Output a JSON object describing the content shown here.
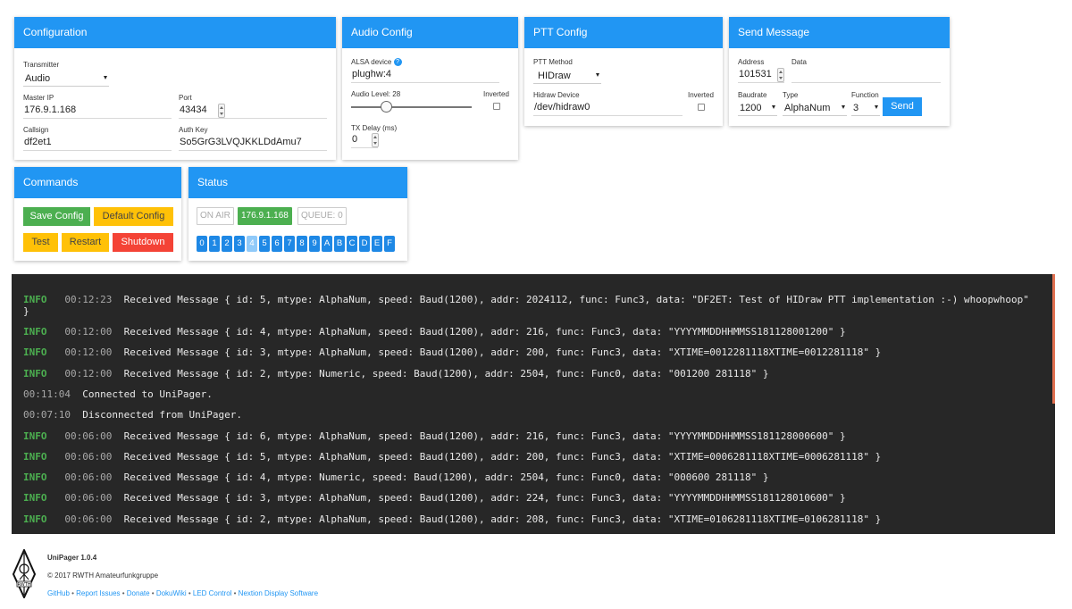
{
  "config": {
    "title": "Configuration",
    "transmitter_label": "Transmitter",
    "transmitter_value": "Audio",
    "master_ip_label": "Master IP",
    "master_ip_value": "176.9.1.168",
    "port_label": "Port",
    "port_value": "43434",
    "callsign_label": "Callsign",
    "callsign_value": "df2et1",
    "auth_key_label": "Auth Key",
    "auth_key_value": "So5GrG3LVQJKKLDdAmu7"
  },
  "audio": {
    "title": "Audio Config",
    "device_label": "ALSA device",
    "device_value": "plughw:4",
    "level_label": "Audio Level: 28",
    "level_value": 28,
    "inverted_label": "Inverted",
    "tx_delay_label": "TX Delay (ms)",
    "tx_delay_value": "0"
  },
  "ptt": {
    "title": "PTT Config",
    "method_label": "PTT Method",
    "method_value": "HIDraw",
    "hidraw_label": "Hidraw Device",
    "hidraw_value": "/dev/hidraw0",
    "inverted_label": "Inverted"
  },
  "send": {
    "title": "Send Message",
    "address_label": "Address",
    "address_value": "101531",
    "data_label": "Data",
    "data_value": "",
    "baudrate_label": "Baudrate",
    "baudrate_value": "1200",
    "type_label": "Type",
    "type_value": "AlphaNum",
    "function_label": "Function",
    "function_value": "3",
    "send_button": "Send"
  },
  "commands": {
    "title": "Commands",
    "save": "Save Config",
    "default": "Default Config",
    "test": "Test",
    "restart": "Restart",
    "shutdown": "Shutdown"
  },
  "status": {
    "title": "Status",
    "on_air": "ON AIR",
    "master": "176.9.1.168",
    "queue": "QUEUE: 0",
    "slots": [
      "0",
      "1",
      "2",
      "3",
      "4",
      "5",
      "6",
      "7",
      "8",
      "9",
      "A",
      "B",
      "C",
      "D",
      "E",
      "F"
    ],
    "active_slot": "4"
  },
  "log": [
    {
      "level": "INFO",
      "time": "00:12:23",
      "msg": "Received Message { id: 5, mtype: AlphaNum, speed: Baud(1200), addr: 2024112, func: Func3, data: \"DF2ET: Test of HIDraw PTT implementation :-) whoopwhoop\"",
      "cont": "}"
    },
    {
      "level": "INFO",
      "time": "00:12:00",
      "msg": "Received Message { id: 4, mtype: AlphaNum, speed: Baud(1200), addr: 216, func: Func3, data: \"YYYYMMDDHHMMSS181128001200\" }"
    },
    {
      "level": "INFO",
      "time": "00:12:00",
      "msg": "Received Message { id: 3, mtype: AlphaNum, speed: Baud(1200), addr: 200, func: Func3, data: \"XTIME=0012281118XTIME=0012281118\" }"
    },
    {
      "level": "INFO",
      "time": "00:12:00",
      "msg": "Received Message { id: 2, mtype: Numeric, speed: Baud(1200), addr: 2504, func: Func0, data: \"001200 281118\" }"
    },
    {
      "level": "",
      "time": "00:11:04",
      "msg": "Connected to UniPager."
    },
    {
      "level": "",
      "time": "00:07:10",
      "msg": "Disconnected from UniPager."
    },
    {
      "level": "INFO",
      "time": "00:06:00",
      "msg": "Received Message { id: 6, mtype: AlphaNum, speed: Baud(1200), addr: 216, func: Func3, data: \"YYYYMMDDHHMMSS181128000600\" }"
    },
    {
      "level": "INFO",
      "time": "00:06:00",
      "msg": "Received Message { id: 5, mtype: AlphaNum, speed: Baud(1200), addr: 200, func: Func3, data: \"XTIME=0006281118XTIME=0006281118\" }"
    },
    {
      "level": "INFO",
      "time": "00:06:00",
      "msg": "Received Message { id: 4, mtype: Numeric, speed: Baud(1200), addr: 2504, func: Func0, data: \"000600 281118\" }"
    },
    {
      "level": "INFO",
      "time": "00:06:00",
      "msg": "Received Message { id: 3, mtype: AlphaNum, speed: Baud(1200), addr: 224, func: Func3, data: \"YYYYMMDDHHMMSS181128010600\" }"
    },
    {
      "level": "INFO",
      "time": "00:06:00",
      "msg": "Received Message { id: 2, mtype: AlphaNum, speed: Baud(1200), addr: 208, func: Func3, data: \"XTIME=0106281118XTIME=0106281118\" }"
    }
  ],
  "footer": {
    "app": "UniPager 1.0.4",
    "copyright": "© 2017 RWTH Amateurfunkgruppe",
    "logo_text": "RWTH",
    "links": [
      "GitHub",
      "Report Issues",
      "Donate",
      "DokuWiki",
      "LED Control",
      "Nextion Display Software"
    ]
  },
  "colors": {
    "primary": "#2196f3",
    "success": "#4caf50",
    "warning": "#ffc107",
    "danger": "#f44336",
    "console_bg": "#272727"
  }
}
